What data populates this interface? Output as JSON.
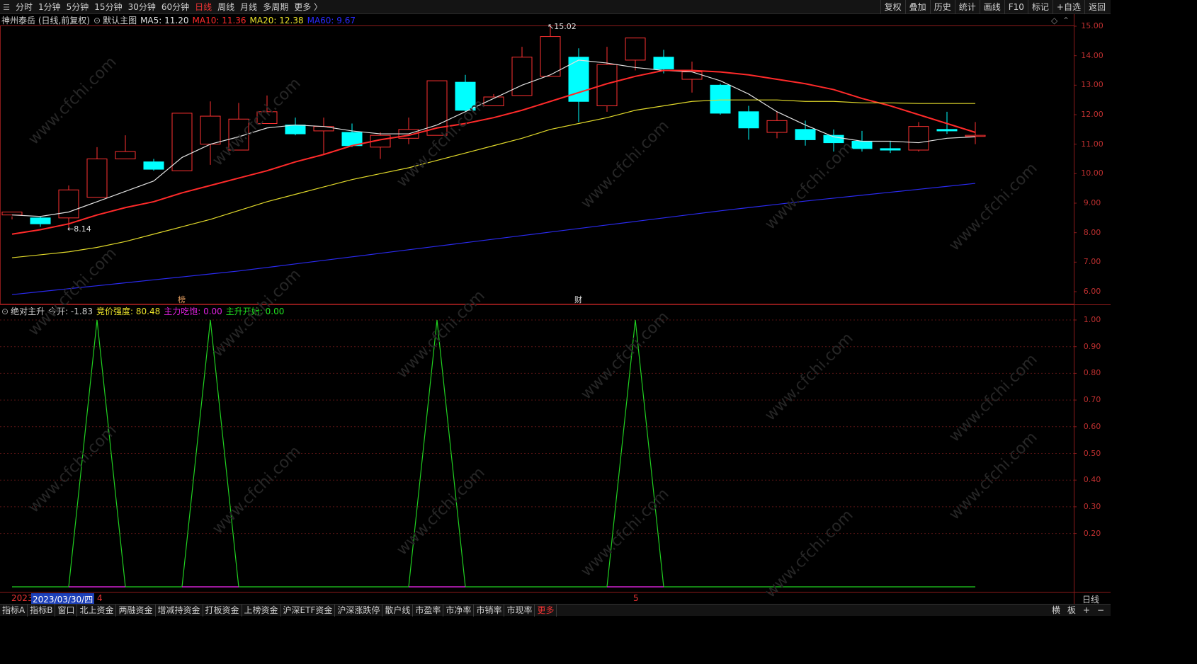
{
  "topbar": {
    "tabs": [
      "分时",
      "1分钟",
      "5分钟",
      "15分钟",
      "30分钟",
      "60分钟",
      "日线",
      "周线",
      "月线",
      "多周期",
      "更多 〉"
    ],
    "active_tab": "日线",
    "right_tools": [
      "复权",
      "叠加",
      "历史",
      "统计",
      "画线",
      "F10",
      "标记",
      "+自选",
      "返回"
    ]
  },
  "main_chart": {
    "title": "神州泰岳 (日线,前复权)",
    "mode": "默认主图",
    "ma": [
      {
        "label": "MA5: 11.20",
        "color": "#e0e0e0"
      },
      {
        "label": "MA10: 11.36",
        "color": "#ff2a2a"
      },
      {
        "label": "MA20: 12.38",
        "color": "#e8e02a"
      },
      {
        "label": "MA60: 9.67",
        "color": "#2a2aff"
      }
    ],
    "high_label": "15.02",
    "low_label": "8.14",
    "y_ticks": [
      "15.00",
      "14.00",
      "13.00",
      "12.00",
      "11.00",
      "10.00",
      "9.00",
      "8.00",
      "7.00",
      "6.00"
    ],
    "event_markers": [
      "榜",
      "财"
    ]
  },
  "indicator_panel": {
    "name": "绝对主升",
    "today_open": "今开: -1.83",
    "metrics": [
      {
        "label": "竞价强度: 80.48",
        "color": "#e8e02a"
      },
      {
        "label": "主力吃饱: 0.00",
        "color": "#e020e0"
      },
      {
        "label": "主升开始: 0.00",
        "color": "#20e020"
      }
    ],
    "y_ticks": [
      "1.00",
      "0.90",
      "0.80",
      "0.70",
      "0.60",
      "0.50",
      "0.40",
      "0.30",
      "0.20"
    ]
  },
  "date_axis": {
    "year": "2023",
    "cursor_date": "2023/03/30/四",
    "markers": [
      "4",
      "5"
    ]
  },
  "period_label": "日线",
  "bottombar": {
    "tabs": [
      "指标A",
      "指标B",
      "窗口",
      "北上资金",
      "两融资金",
      "增减持资金",
      "打板资金",
      "上榜资金",
      "沪深ETF资金",
      "沪深涨跌停",
      "散户线",
      "市盈率",
      "市净率",
      "市销率",
      "市现率",
      "更多"
    ],
    "active_tab": "更多",
    "right": [
      "横",
      "板",
      "+",
      "−"
    ]
  },
  "watermark": "www.cfchi.com",
  "chart_data": {
    "type": "candlestick",
    "ylim": [
      5.7,
      15.3
    ],
    "candles": [
      [
        8.6,
        8.7,
        8.45,
        8.55
      ],
      [
        8.5,
        8.3,
        8.2,
        8.55
      ],
      [
        8.5,
        9.45,
        8.1,
        9.6
      ],
      [
        9.2,
        10.5,
        9.2,
        10.9
      ],
      [
        10.5,
        10.75,
        10.6,
        11.3
      ],
      [
        10.4,
        10.15,
        10.1,
        10.5
      ],
      [
        10.1,
        12.05,
        10.1,
        12.05
      ],
      [
        11.0,
        11.95,
        10.3,
        12.45
      ],
      [
        10.8,
        11.85,
        10.8,
        12.4
      ],
      [
        11.7,
        12.1,
        11.7,
        12.65
      ],
      [
        11.65,
        11.35,
        11.3,
        11.9
      ],
      [
        11.45,
        11.6,
        10.65,
        11.9
      ],
      [
        11.4,
        10.95,
        10.9,
        11.7
      ],
      [
        10.9,
        11.3,
        10.5,
        11.4
      ],
      [
        11.2,
        11.5,
        11.0,
        11.9
      ],
      [
        11.3,
        13.15,
        11.3,
        13.15
      ],
      [
        13.1,
        12.15,
        12.1,
        13.35
      ],
      [
        12.3,
        12.6,
        12.3,
        12.7
      ],
      [
        12.65,
        13.95,
        12.65,
        14.3
      ],
      [
        13.3,
        14.65,
        13.3,
        15.02
      ],
      [
        13.95,
        12.45,
        11.75,
        14.25
      ],
      [
        12.3,
        13.7,
        12.1,
        14.3
      ],
      [
        13.85,
        14.6,
        13.5,
        14.6
      ],
      [
        13.95,
        13.55,
        13.4,
        14.2
      ],
      [
        13.2,
        13.45,
        12.75,
        13.8
      ],
      [
        13.0,
        12.05,
        12.0,
        13.05
      ],
      [
        12.1,
        11.55,
        11.15,
        12.3
      ],
      [
        11.4,
        11.8,
        11.2,
        12.1
      ],
      [
        11.5,
        11.15,
        10.95,
        11.8
      ],
      [
        11.3,
        11.05,
        10.75,
        11.5
      ],
      [
        11.1,
        10.85,
        10.75,
        11.45
      ],
      [
        10.85,
        10.8,
        10.7,
        11.1
      ],
      [
        10.8,
        11.6,
        10.75,
        11.75
      ],
      [
        11.5,
        11.45,
        11.35,
        12.1
      ],
      [
        11.3,
        11.3,
        11.0,
        11.75
      ]
    ],
    "series": [
      {
        "name": "MA5",
        "values": [
          8.6,
          8.55,
          8.7,
          9.05,
          9.4,
          9.75,
          10.55,
          11.0,
          11.25,
          11.55,
          11.65,
          11.6,
          11.45,
          11.35,
          11.35,
          11.65,
          12.1,
          12.55,
          13.0,
          13.35,
          13.85,
          13.75,
          13.6,
          13.5,
          13.45,
          13.15,
          12.7,
          12.1,
          11.65,
          11.25,
          11.1,
          11.1,
          11.05,
          11.2,
          11.25
        ]
      },
      {
        "name": "MA10",
        "values": [
          7.95,
          8.1,
          8.3,
          8.6,
          8.85,
          9.05,
          9.35,
          9.6,
          9.85,
          10.1,
          10.4,
          10.65,
          10.95,
          11.15,
          11.3,
          11.55,
          11.7,
          11.9,
          12.15,
          12.45,
          12.75,
          13.05,
          13.3,
          13.5,
          13.5,
          13.45,
          13.35,
          13.2,
          13.05,
          12.85,
          12.55,
          12.3,
          12.0,
          11.7,
          11.4
        ]
      },
      {
        "name": "MA20",
        "values": [
          7.15,
          7.25,
          7.35,
          7.5,
          7.7,
          7.95,
          8.2,
          8.45,
          8.75,
          9.05,
          9.3,
          9.55,
          9.8,
          10.0,
          10.2,
          10.45,
          10.7,
          10.95,
          11.2,
          11.5,
          11.7,
          11.9,
          12.15,
          12.3,
          12.45,
          12.5,
          12.5,
          12.5,
          12.45,
          12.45,
          12.4,
          12.4,
          12.38,
          12.38,
          12.38
        ]
      },
      {
        "name": "MA60",
        "values": [
          5.9,
          6.0,
          6.1,
          6.2,
          6.3,
          6.4,
          6.5,
          6.6,
          6.7,
          6.82,
          6.94,
          7.06,
          7.18,
          7.3,
          7.42,
          7.54,
          7.66,
          7.78,
          7.9,
          8.02,
          8.14,
          8.26,
          8.38,
          8.5,
          8.62,
          8.74,
          8.85,
          8.96,
          9.07,
          9.17,
          9.27,
          9.37,
          9.47,
          9.57,
          9.67
        ]
      }
    ],
    "indicator": {
      "ylim": [
        0,
        1.05
      ],
      "peaks": [
        3,
        7,
        15,
        22
      ],
      "values": [
        0,
        0,
        0,
        1,
        0,
        0,
        0,
        1,
        0,
        0,
        0,
        0,
        0,
        0,
        0,
        1,
        0,
        0,
        0,
        0,
        0,
        0,
        1,
        0,
        0,
        0,
        0,
        0,
        0,
        0,
        0,
        0,
        0,
        0,
        0
      ]
    }
  }
}
